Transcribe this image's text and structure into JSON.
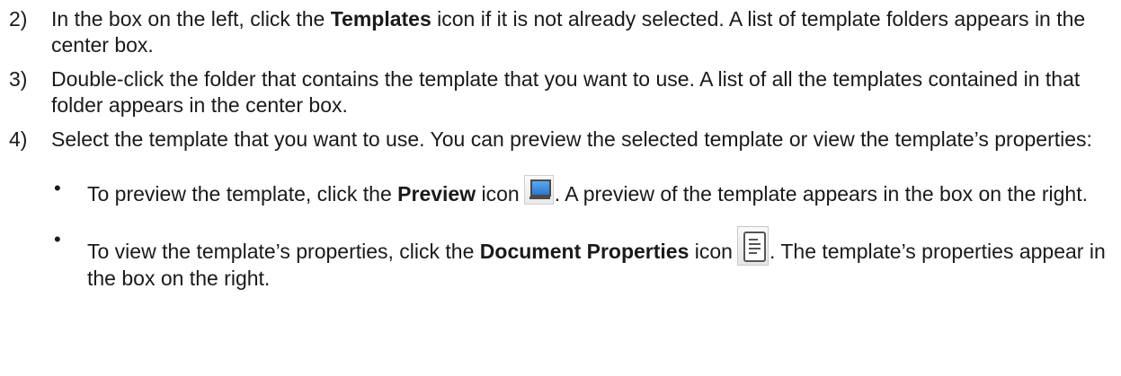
{
  "steps": [
    {
      "number": "2)",
      "text_1": "In the box on the left, click the ",
      "bold_1": "Templates",
      "text_2": " icon if it is not already selected. A list of template folders appears in the center box."
    },
    {
      "number": "3)",
      "text_1": "Double-click the folder that contains the template that you want to use. A list of all the templates contained in that folder appears in the center box."
    },
    {
      "number": "4)",
      "text_1": "Select the template that you want to use. You can preview the selected template or view the template’s properties:"
    }
  ],
  "bullets": [
    {
      "symbol": "•",
      "text_1": "To preview the template, click the ",
      "bold_1": "Preview",
      "text_2": " icon",
      "icon": "preview-icon",
      "text_3": ". A preview of the template appears in the box on the right."
    },
    {
      "symbol": "•",
      "text_1": "To view the template’s properties, click the ",
      "bold_1": "Document Properties",
      "text_2": " icon",
      "icon": "document-properties-icon",
      "text_3": ". The template’s properties appear in the box on the right."
    }
  ],
  "colors": {
    "text": "#1a1a1a",
    "preview_screen": "#2b78cf"
  }
}
